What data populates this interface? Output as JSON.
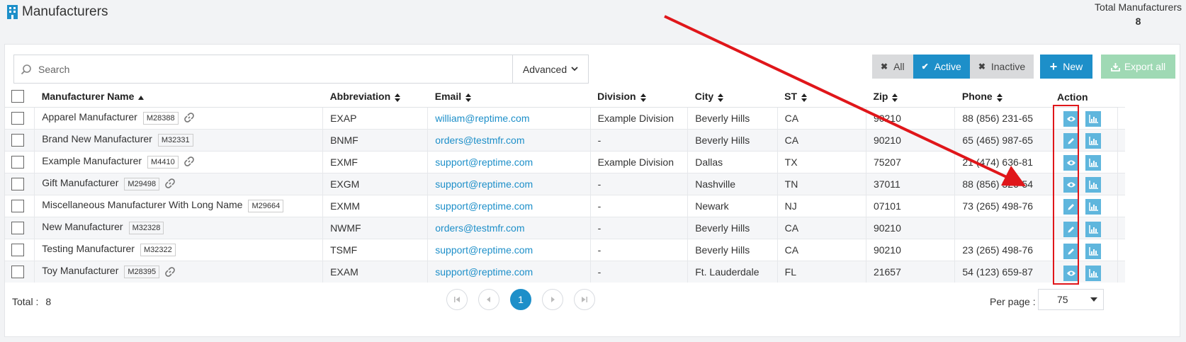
{
  "header": {
    "title": "Manufacturers",
    "total_label": "Total Manufacturers",
    "total_value": "8"
  },
  "toolbar": {
    "search_placeholder": "Search",
    "advanced_label": "Advanced",
    "filters": {
      "all": "All",
      "active": "Active",
      "inactive": "Inactive"
    },
    "new_label": "New",
    "export_label": "Export all"
  },
  "table": {
    "columns": {
      "name": "Manufacturer Name",
      "abbr": "Abbreviation",
      "email": "Email",
      "division": "Division",
      "city": "City",
      "st": "ST",
      "zip": "Zip",
      "phone": "Phone",
      "action": "Action"
    },
    "rows": [
      {
        "name": "Apparel Manufacturer",
        "code": "M28388",
        "abbr": "EXAP",
        "email": "william@reptime.com",
        "division": "Example Division",
        "city": "Beverly Hills",
        "st": "CA",
        "zip": "90210",
        "phone": "88 (856) 231-65"
      },
      {
        "name": "Brand New Manufacturer",
        "code": "M32331",
        "abbr": "BNMF",
        "email": "orders@testmfr.com",
        "division": "-",
        "city": "Beverly Hills",
        "st": "CA",
        "zip": "90210",
        "phone": "65 (465) 987-65"
      },
      {
        "name": "Example Manufacturer",
        "code": "M4410",
        "abbr": "EXMF",
        "email": "support@reptime.com",
        "division": "Example Division",
        "city": "Dallas",
        "st": "TX",
        "zip": "75207",
        "phone": "21 (474) 636-81"
      },
      {
        "name": "Gift Manufacturer",
        "code": "M29498",
        "abbr": "EXGM",
        "email": "support@reptime.com",
        "division": "-",
        "city": "Nashville",
        "st": "TN",
        "zip": "37011",
        "phone": "88 (856) 326-54"
      },
      {
        "name": "Miscellaneous Manufacturer With Long Name",
        "code": "M29664",
        "abbr": "EXMM",
        "email": "support@reptime.com",
        "division": "-",
        "city": "Newark",
        "st": "NJ",
        "zip": "07101",
        "phone": "73 (265) 498-76"
      },
      {
        "name": "New Manufacturer",
        "code": "M32328",
        "abbr": "NWMF",
        "email": "orders@testmfr.com",
        "division": "-",
        "city": "Beverly Hills",
        "st": "CA",
        "zip": "90210",
        "phone": ""
      },
      {
        "name": "Testing Manufacturer",
        "code": "M32322",
        "abbr": "TSMF",
        "email": "support@reptime.com",
        "division": "-",
        "city": "Beverly Hills",
        "st": "CA",
        "zip": "90210",
        "phone": "23 (265) 498-76"
      },
      {
        "name": "Toy Manufacturer",
        "code": "M28395",
        "abbr": "EXAM",
        "email": "support@reptime.com",
        "division": "-",
        "city": "Ft. Lauderdale",
        "st": "FL",
        "zip": "21657",
        "phone": "54 (123) 659-87"
      }
    ],
    "row_link_icon": [
      "link-icon",
      "",
      "link-icon",
      "link-icon",
      "",
      "",
      "",
      "link-icon"
    ],
    "row_first_action": [
      "eye-icon",
      "pencil-icon",
      "eye-icon",
      "eye-icon",
      "pencil-icon",
      "pencil-icon",
      "pencil-icon",
      "eye-icon"
    ]
  },
  "footer": {
    "total_label": "Total :",
    "total_value": "8",
    "current_page": "1",
    "per_page_label": "Per page :",
    "per_page_value": "75"
  },
  "colors": {
    "primary": "#1d8fc9",
    "action_button": "#5fb6dd",
    "export_button": "#9fd9b4",
    "annotation": "#e0161a"
  }
}
